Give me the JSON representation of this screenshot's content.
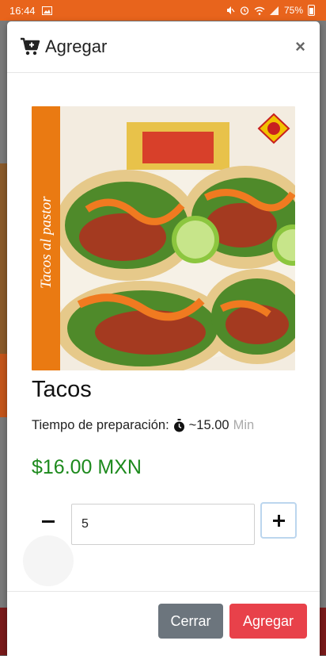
{
  "status_bar": {
    "time": "16:44",
    "battery": "75%",
    "icons": [
      "gallery-icon",
      "mute-icon",
      "alarm-icon",
      "wifi-icon",
      "signal-icon",
      "battery-icon"
    ]
  },
  "modal": {
    "title": "Agregar",
    "title_icon": "cart-plus-icon",
    "close_symbol": "×"
  },
  "product": {
    "image_banner_text": "Tacos al pastor",
    "name": "Tacos",
    "prep_label": "Tiempo de preparación:",
    "prep_value": "~15.00",
    "prep_unit": "Min",
    "price": "$16.00 MXN"
  },
  "quantity": {
    "value": "5",
    "minus_symbol": "−",
    "plus_symbol": "+"
  },
  "footer": {
    "close_label": "Cerrar",
    "add_label": "Agregar"
  },
  "colors": {
    "status_bar": "#e8641c",
    "price": "#1d8a1d",
    "close_button": "#6c757d",
    "add_button": "#e8414a"
  }
}
